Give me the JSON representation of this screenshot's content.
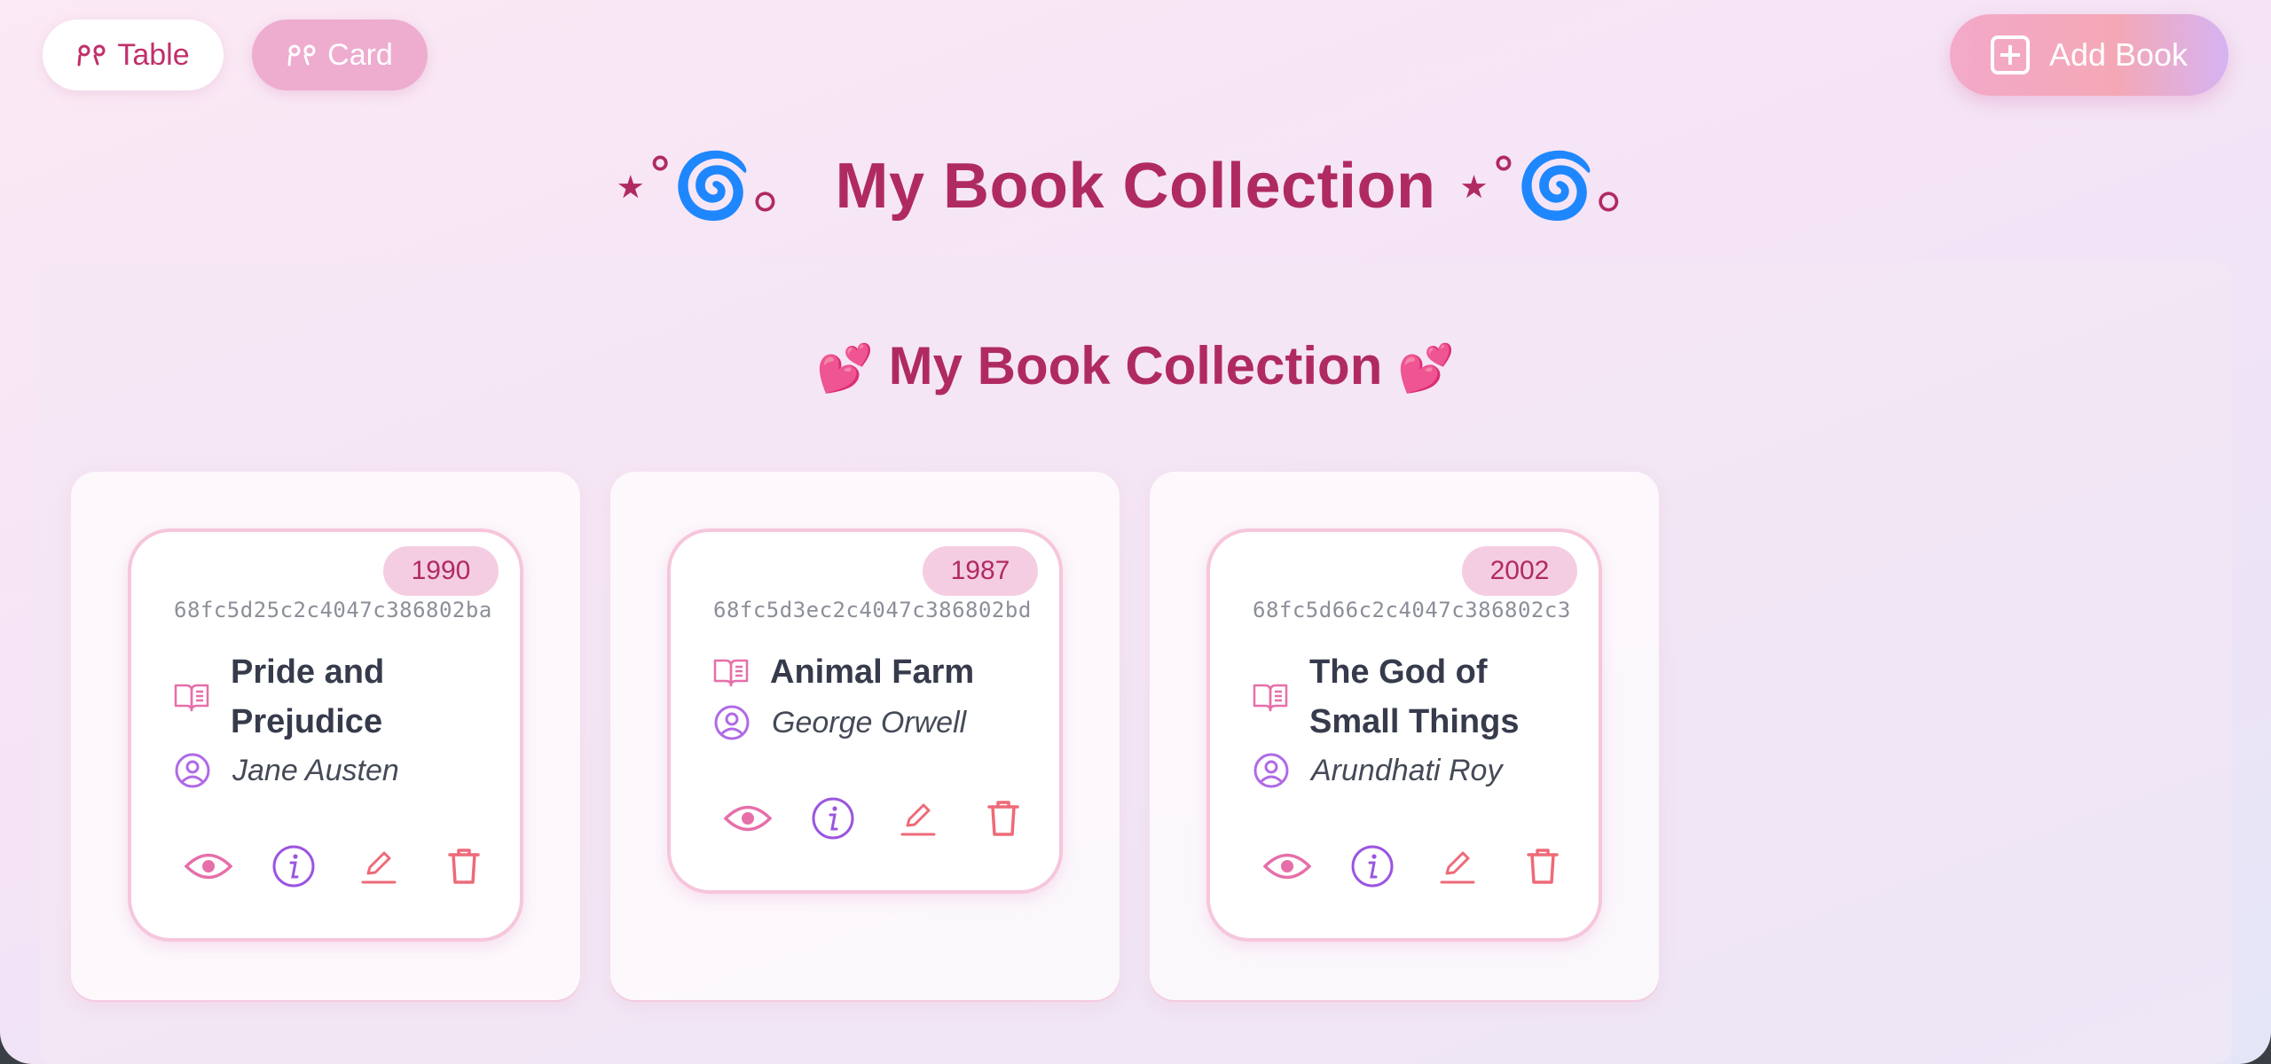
{
  "toolbar": {
    "table_label": "Table",
    "card_label": "Card",
    "add_label": "Add Book",
    "view_icon": "glasses-icon"
  },
  "page": {
    "title": "My Book Collection",
    "title_deco": "⋆˚🌀。",
    "subtitle": "My Book Collection",
    "subtitle_deco": "💕"
  },
  "colors": {
    "accent": "#b02a62",
    "pink_icon": "#e66faa",
    "purple_icon": "#9b55e0",
    "red_icon": "#ee6a78"
  },
  "books": [
    {
      "year": "1990",
      "id": "68fc5d25c2c4047c386802ba",
      "title": "Pride and Prejudice",
      "author": "Jane Austen"
    },
    {
      "year": "1987",
      "id": "68fc5d3ec2c4047c386802bd",
      "title": "Animal Farm",
      "author": "George Orwell"
    },
    {
      "year": "2002",
      "id": "68fc5d66c2c4047c386802c3",
      "title": "The God of Small Things",
      "author": "Arundhati Roy"
    }
  ]
}
